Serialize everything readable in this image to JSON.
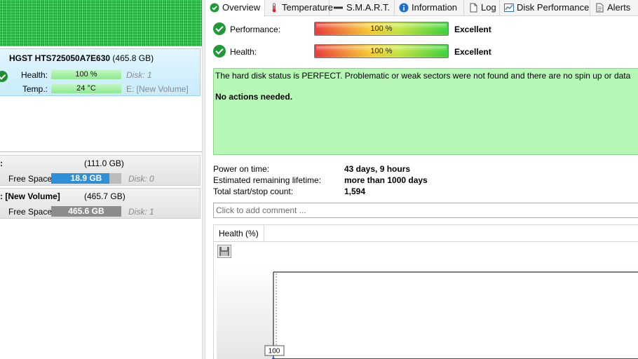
{
  "left": {
    "disk": {
      "model": "HGST HTS725050A7E630",
      "size": "(465.8 GB)",
      "health_label": "Health:",
      "health_value": "100 %",
      "health_fraction": 1.0,
      "disk_ref": "Disk: 1",
      "temp_label": "Temp.:",
      "temp_value": "24 °C",
      "temp_volume": "E: [New Volume]"
    },
    "volumes": [
      {
        "name": ":",
        "size": "(111.0 GB)",
        "free_label": "Free Space",
        "free_value": "18.9 GB",
        "free_fraction": 0.83,
        "disk_ref": "Disk: 0",
        "bar_color": "#2f8fd8"
      },
      {
        "name": ": [New Volume]",
        "size": "(465.7 GB)",
        "free_label": "Free Space",
        "free_value": "465.6 GB",
        "free_fraction": 1.0,
        "disk_ref": "Disk: 1",
        "bar_color": "#8c8c8c"
      }
    ]
  },
  "tabs": [
    {
      "label": "Overview",
      "icon": "check-circle-icon",
      "active": true
    },
    {
      "label": "Temperature",
      "icon": "thermometer-icon",
      "active": false
    },
    {
      "label": "S.M.A.R.T.",
      "icon": "smart-bar-icon",
      "active": false
    },
    {
      "label": "Information",
      "icon": "info-icon",
      "active": false
    },
    {
      "label": "Log",
      "icon": "log-document-icon",
      "active": false
    },
    {
      "label": "Disk Performance",
      "icon": "performance-chart-icon",
      "active": false
    },
    {
      "label": "Alerts",
      "icon": "alerts-document-icon",
      "active": false
    }
  ],
  "overview": {
    "performance_label": "Performance:",
    "performance_value": "100 %",
    "performance_fraction": 1.0,
    "performance_rating": "Excellent",
    "health_label": "Health:",
    "health_value": "100 %",
    "health_fraction": 1.0,
    "health_rating": "Excellent",
    "status_message": "The hard disk status is PERFECT. Problematic or weak sectors were not found and there are no spin up or data",
    "status_action": "No actions needed.",
    "status_bg": "#b6f7b6",
    "power_on_label": "Power on time:",
    "power_on_value": "43 days, 9 hours",
    "lifetime_label": "Estimated remaining lifetime:",
    "lifetime_value": "more than 1000 days",
    "startstop_label": "Total start/stop count:",
    "startstop_value": "1,594",
    "comment_placeholder": "Click to add comment ..."
  },
  "chart_tab": {
    "label": "Health (%)",
    "save_icon": "floppy-save-icon"
  },
  "chart_data": {
    "type": "line",
    "x": [],
    "series": [
      {
        "values": [
          100
        ]
      }
    ],
    "data_labels": [
      "100"
    ],
    "grid": false
  }
}
